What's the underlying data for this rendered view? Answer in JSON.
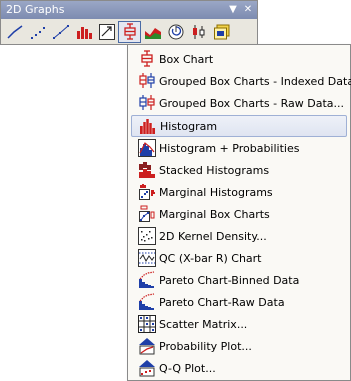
{
  "toolbar": {
    "title": "2D Graphs",
    "buttons": [
      {
        "icon": "line-plot-icon"
      },
      {
        "icon": "scatter-plot-icon"
      },
      {
        "icon": "line-symbol-icon"
      },
      {
        "icon": "column-chart-icon"
      },
      {
        "icon": "vector-plot-icon"
      },
      {
        "icon": "box-chart-icon",
        "pressed": true
      },
      {
        "icon": "area-chart-icon"
      },
      {
        "icon": "polar-chart-icon"
      },
      {
        "icon": "hi-lo-chart-icon"
      },
      {
        "icon": "template-icon"
      }
    ]
  },
  "menu": {
    "items": [
      {
        "label": "Box Chart",
        "icon": "box-chart-icon"
      },
      {
        "label": "Grouped Box Charts - Indexed Data...",
        "icon": "grouped-box-indexed-icon"
      },
      {
        "label": "Grouped Box Charts - Raw Data...",
        "icon": "grouped-box-raw-icon"
      },
      {
        "label": "Histogram",
        "icon": "histogram-icon",
        "highlighted": true
      },
      {
        "label": "Histogram + Probabilities",
        "icon": "histogram-probabilities-icon"
      },
      {
        "label": "Stacked Histograms",
        "icon": "stacked-histograms-icon"
      },
      {
        "label": "Marginal Histograms",
        "icon": "marginal-histograms-icon"
      },
      {
        "label": "Marginal Box Charts",
        "icon": "marginal-box-charts-icon"
      },
      {
        "label": "2D Kernel Density...",
        "icon": "kernel-density-icon"
      },
      {
        "label": "QC (X-bar R) Chart",
        "icon": "qc-chart-icon"
      },
      {
        "label": "Pareto Chart-Binned Data",
        "icon": "pareto-binned-icon"
      },
      {
        "label": "Pareto Chart-Raw Data",
        "icon": "pareto-raw-icon"
      },
      {
        "label": "Scatter Matrix...",
        "icon": "scatter-matrix-icon"
      },
      {
        "label": "Probability Plot...",
        "icon": "probability-plot-icon"
      },
      {
        "label": "Q-Q Plot...",
        "icon": "qq-plot-icon"
      }
    ]
  },
  "colors": {
    "title_bar": "#8592b5",
    "accent_red": "#cc1f1f",
    "accent_blue": "#1f3fa8",
    "highlight_border": "#9fb0d5"
  }
}
